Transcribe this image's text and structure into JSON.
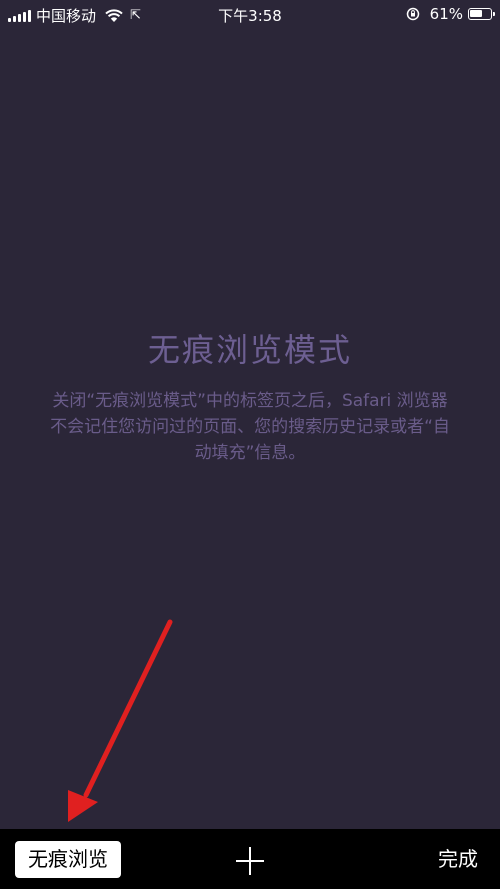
{
  "status_bar": {
    "carrier": "中国移动",
    "time": "下午3:58",
    "battery_percent": "61%",
    "battery_level": 0.61,
    "icons": [
      "signal-icon",
      "wifi-icon",
      "location-arrow-icon",
      "rotation-lock-icon",
      "battery-icon"
    ]
  },
  "main": {
    "title": "无痕浏览模式",
    "description": "关闭“无痕浏览模式”中的标签页之后，Safari 浏览器不会记住您访问过的页面、您的搜索历史记录或者“自动填充”信息。"
  },
  "toolbar": {
    "private_label": "无痕浏览",
    "add_icon": "plus-icon",
    "done_label": "完成"
  },
  "annotation": {
    "arrow_color": "#e02020",
    "icon": "red-arrow-icon"
  },
  "colors": {
    "background": "#2b2638",
    "title_text": "#6d5f92",
    "toolbar_bg": "#000000"
  }
}
